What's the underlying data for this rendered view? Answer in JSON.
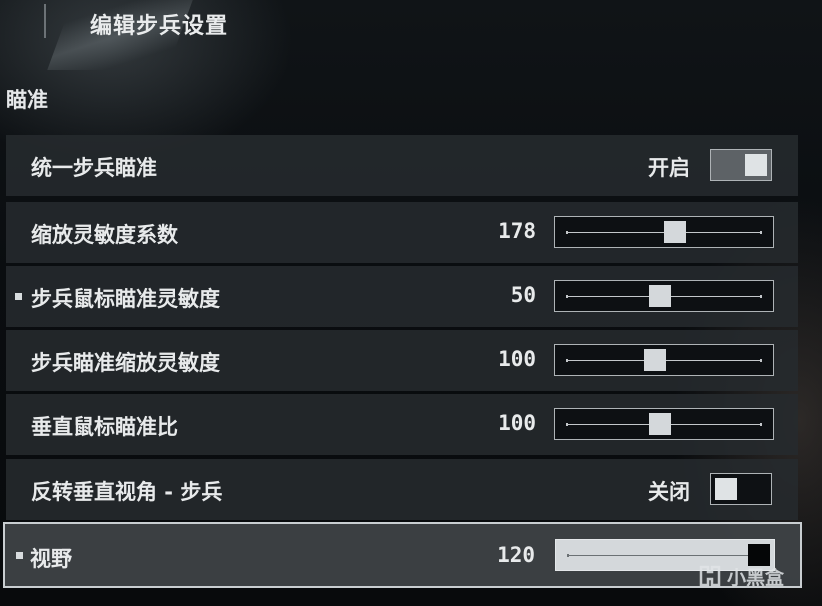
{
  "header": {
    "title": "编辑步兵设置"
  },
  "section": {
    "title": "瞄准"
  },
  "rows": [
    {
      "label": "统一步兵瞄准",
      "type": "toggle",
      "state_label": "开启",
      "on": true,
      "marker": false
    },
    {
      "label": "缩放灵敏度系数",
      "type": "slider",
      "value": "178",
      "fraction": 0.56,
      "marker": false
    },
    {
      "label": "步兵鼠标瞄准灵敏度",
      "type": "slider",
      "value": "50",
      "fraction": 0.48,
      "marker": true
    },
    {
      "label": "步兵瞄准缩放灵敏度",
      "type": "slider",
      "value": "100",
      "fraction": 0.45,
      "marker": false
    },
    {
      "label": "垂直鼠标瞄准比",
      "type": "slider",
      "value": "100",
      "fraction": 0.48,
      "marker": false
    },
    {
      "label": "反转垂直视角 - 步兵",
      "type": "toggle",
      "state_label": "关闭",
      "on": false,
      "marker": false
    },
    {
      "label": "视野",
      "type": "slider",
      "value": "120",
      "fraction": 1.0,
      "marker": true,
      "selected": true
    }
  ],
  "watermark": {
    "text": "小黑盒"
  }
}
